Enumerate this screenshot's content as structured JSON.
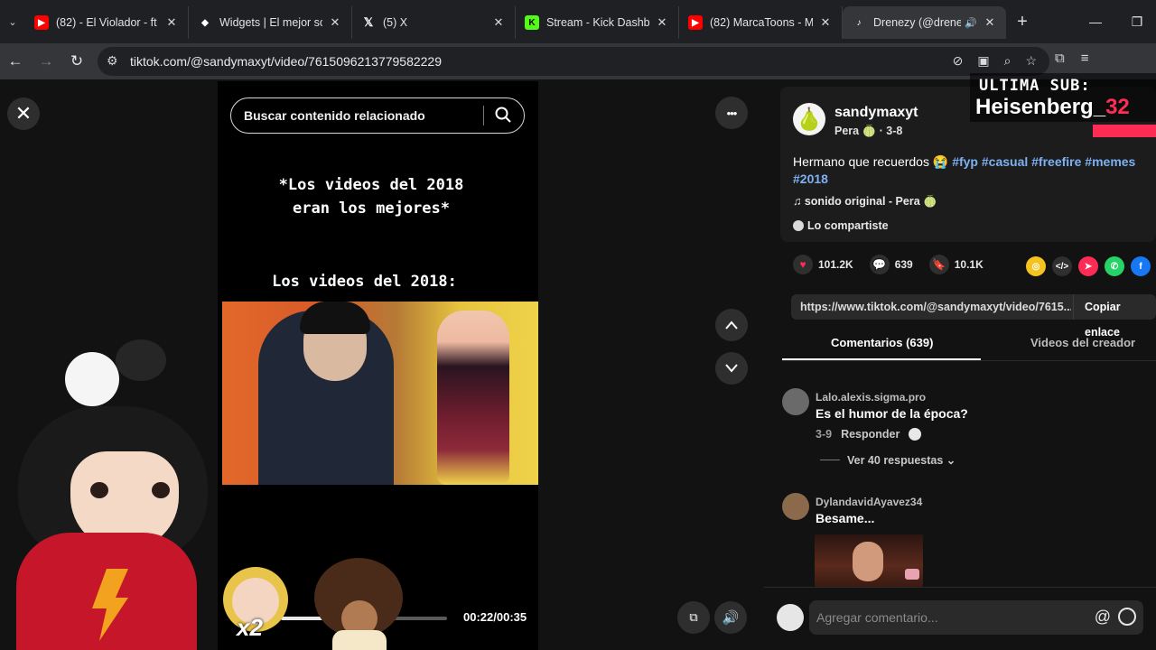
{
  "browser": {
    "tabs": [
      {
        "title": "(82) - El Violador - ft",
        "favicon": "youtube",
        "color": "#ff0000"
      },
      {
        "title": "Widgets | El mejor so",
        "favicon": "widgets",
        "color": "#ffffff"
      },
      {
        "title": "(5) X",
        "favicon": "x",
        "color": "#ffffff"
      },
      {
        "title": "Stream - Kick Dashbo",
        "favicon": "kick",
        "color": "#53fc18"
      },
      {
        "title": "(82) MarcaToons - M",
        "favicon": "youtube",
        "color": "#ff0000"
      },
      {
        "title": "Drenezy (@drene",
        "favicon": "tiktok",
        "color": "#ffffff",
        "active": true
      }
    ],
    "new_tab": "+",
    "address": "tiktok.com/@sandymaxyt/video/7615096213779582229"
  },
  "player": {
    "close": "✕",
    "search_placeholder": "Buscar contenido relacionado",
    "caption_top_1": "*Los videos del 2018",
    "caption_top_2": "eran los mejores*",
    "caption_mid": "Los videos del 2018:",
    "time": "00:22/00:35",
    "progress": 0.63,
    "x2": "x2",
    "more": "•••",
    "prev": "⌃",
    "next": "⌄"
  },
  "overlay": {
    "line1": "ULTIMA SUB:",
    "line2": "Heisenberg_",
    "line2_tail": "32"
  },
  "post": {
    "author": "sandymaxyt",
    "author_sub": "Pera 🍈 · 3-8",
    "desc_text": "Hermano que recuerdos 😭 ",
    "tags": [
      "#fyp",
      "#casual",
      "#freefire",
      "#memes",
      "#2018"
    ],
    "sound": "♫  sonido original - Pera 🍈",
    "shared": "Lo compartiste",
    "likes": "101.2K",
    "comments": "639",
    "saves": "10.1K",
    "link": "https://www.tiktok.com/@sandymaxyt/video/7615...",
    "copy_link": "Copiar enlace",
    "tab_comments": "Comentarios (639)",
    "tab_creator": "Videos del creador"
  },
  "comments": [
    {
      "user": "Lalo.alexis.sigma.pro",
      "text": "Es el humor de la época?",
      "date": "3-9",
      "reply": "Responder"
    },
    {
      "user": "DylandavidAyavez34",
      "text": "Besame..."
    }
  ],
  "view_replies": "Ver 40 respuestas ⌄",
  "comment_placeholder": "Agregar comentario..."
}
